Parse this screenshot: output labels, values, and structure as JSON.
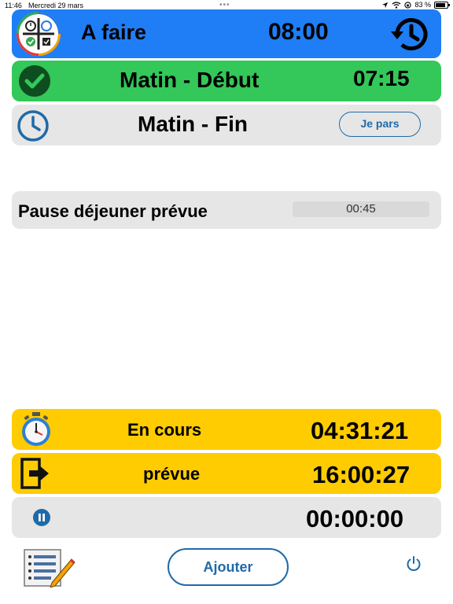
{
  "status_bar": {
    "time": "11:46",
    "date": "Mercredi 29 mars",
    "dots": "•••",
    "battery": "83 %",
    "battery_level_percent": 83
  },
  "header": {
    "title": "A faire",
    "time": "08:00"
  },
  "morning_start": {
    "label": "Matin - Début",
    "time": "07:15"
  },
  "morning_end": {
    "label": "Matin - Fin",
    "button_label": "Je pars"
  },
  "lunch_break": {
    "label": "Pause déjeuner prévue",
    "value": "00:45"
  },
  "in_progress": {
    "label": "En cours",
    "time": "04:31:21"
  },
  "planned": {
    "label": "prévue",
    "time": "16:00:27"
  },
  "pause_timer": {
    "time": "00:00:00"
  },
  "footer": {
    "add_button_label": "Ajouter"
  },
  "colors": {
    "header_blue": "#1f7ef5",
    "start_green": "#34c759",
    "neutral_gray": "#e6e6e6",
    "timer_yellow": "#fecc00",
    "accent_blue": "#1f6aa8"
  },
  "icons": [
    "app-logo-icon",
    "history-icon",
    "checkmark-circle-icon",
    "clock-icon",
    "stopwatch-icon",
    "exit-arrow-icon",
    "pause-circle-icon",
    "list-edit-icon",
    "power-icon",
    "location-arrow-icon",
    "wifi-icon",
    "battery-icon"
  ]
}
